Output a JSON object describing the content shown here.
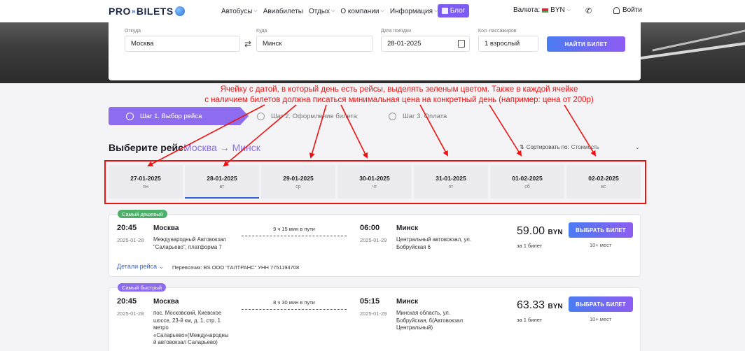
{
  "header": {
    "logo_text": "PRO",
    "logo_text2": "BILETS",
    "nav": [
      {
        "label": "Автобусы",
        "dropdown": true
      },
      {
        "label": "Авиабилеты",
        "dropdown": false
      },
      {
        "label": "Отдых",
        "dropdown": true
      },
      {
        "label": "О компании",
        "dropdown": true
      },
      {
        "label": "Информация",
        "dropdown": true
      }
    ],
    "blog_label": "Блог",
    "currency_label": "Валюта:",
    "currency_value": "BYN",
    "login_label": "Войти"
  },
  "search": {
    "from_label": "Откуда",
    "from_value": "Москва",
    "to_label": "Куда",
    "to_value": "Минск",
    "date_label": "Дата поездки",
    "date_value": "28-01-2025",
    "pax_label": "Кол. пассажиров",
    "pax_value": "1 взрослый",
    "button_label": "НАЙТИ БИЛЕТ"
  },
  "annotation": {
    "line1": "Ячейку с датой, в который день есть рейсы, выделять зеленым цветом. Также в каждой ячейке",
    "line2": "с наличием билетов должна писаться минимальная цена на конкретный день (например: цена от 200р)",
    "color": "#ee1111"
  },
  "steps": [
    {
      "label": "Шаг 1. Выбор рейса",
      "active": true
    },
    {
      "label": "Шаг 2. Оформление билета",
      "active": false
    },
    {
      "label": "Шаг 3. Оплата",
      "active": false
    }
  ],
  "route": {
    "title": "Выберите рейс:",
    "cities": "Москва → Минск",
    "sort_label": "Сортировать по:",
    "sort_value": "Стоимость"
  },
  "dates": [
    {
      "date": "27-01-2025",
      "weekday": "пн",
      "active": false
    },
    {
      "date": "28-01-2025",
      "weekday": "вт",
      "active": true
    },
    {
      "date": "29-01-2025",
      "weekday": "ср",
      "active": false
    },
    {
      "date": "30-01-2025",
      "weekday": "чт",
      "active": false
    },
    {
      "date": "31-01-2025",
      "weekday": "пт",
      "active": false
    },
    {
      "date": "01-02-2025",
      "weekday": "сб",
      "active": false
    },
    {
      "date": "02-02-2025",
      "weekday": "вс",
      "active": false
    }
  ],
  "trips": [
    {
      "badge": "Самый дешевый",
      "badge_color": "#4caf6a",
      "dep_time": "20:45",
      "dep_date": "2025-01-28",
      "dep_city": "Москва",
      "dep_addr": [
        "Международный Автовокзал",
        "\"Саларьево\", платформа 7"
      ],
      "duration": "9 ч 15 мин в пути",
      "arr_time": "06:00",
      "arr_date": "2025-01-29",
      "arr_city": "Минск",
      "arr_addr": [
        "Центральный автовокзал, ул.",
        "Бобруйская 6"
      ],
      "price": "59.00",
      "currency": "BYN",
      "per": "за 1 билет",
      "buy_label": "ВЫБРАТЬ БИЛЕТ",
      "seats": "10+ мест",
      "details_label": "Детали рейса",
      "carrier": "Перевозчик: BS ООО \"ГАЛТРАНС\" УНН 7751194708"
    },
    {
      "badge": "Самый быстрый",
      "badge_color": "#8e6cf0",
      "dep_time": "20:45",
      "dep_date": "2025-01-28",
      "dep_city": "Москва",
      "dep_addr": [
        "пос. Московский, Киевское",
        "шоссе, 23-й км, д. 1, стр. 1",
        "метро",
        "«Саларьево»(Международны",
        "й автовокзал Саларьево)"
      ],
      "duration": "8 ч 30 мин в пути",
      "arr_time": "05:15",
      "arr_date": "2025-01-29",
      "arr_city": "Минск",
      "arr_addr": [
        "Минская область, ул.",
        "Бобруйская, 6(Автовокзал",
        "Центральный)"
      ],
      "price": "63.33",
      "currency": "BYN",
      "per": "за 1 билет",
      "buy_label": "ВЫБРАТЬ БИЛЕТ",
      "seats": "10+ мест"
    }
  ]
}
